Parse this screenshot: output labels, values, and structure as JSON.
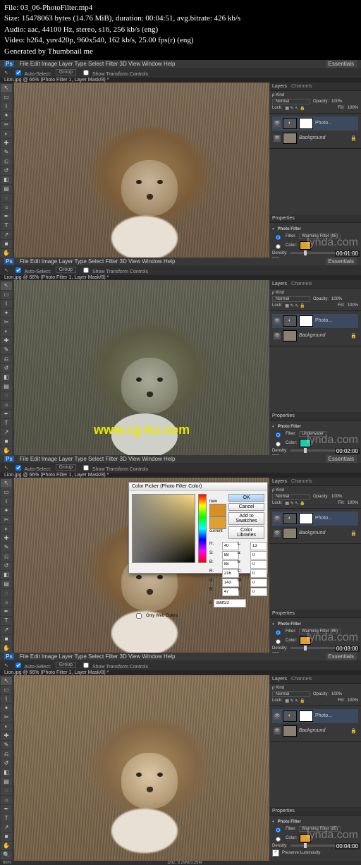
{
  "header": {
    "file": "File: 03_06-PhotoFilter.mp4",
    "size": "Size: 15478063 bytes (14.76 MiB), duration: 00:04:51, avg.bitrate: 426 kb/s",
    "audio": "Audio: aac, 44100 Hz, stereo, s16, 256 kb/s (eng)",
    "video": "Video: h264, yuv420p, 960x540, 162 kb/s, 25.00 fps(r) (eng)",
    "generated": "Generated by Thumbnail me"
  },
  "menu": {
    "ps": "Ps",
    "items": [
      "File",
      "Edit",
      "Image",
      "Layer",
      "Type",
      "Select",
      "Filter",
      "3D",
      "View",
      "Window",
      "Help"
    ]
  },
  "options": {
    "auto_select": "Auto-Select:",
    "group": "Group",
    "show_transform": "Show Transform Controls"
  },
  "essentials": "Essentials",
  "tab": "Lion.jpg @ 66% (Photo Filter 1, Layer Mask/8) *",
  "status_left": "66%",
  "status_doc": "Doc: 3.29M/3.29M",
  "layers_panel": {
    "tabs": [
      "Layers",
      "Channels"
    ],
    "kind": "ρ Kind",
    "blend": "Normal",
    "opacity_label": "Opacity:",
    "opacity": "100%",
    "lock_label": "Lock:",
    "fill_label": "Fill:",
    "fill": "100%",
    "layer1": "Photo...",
    "layer_bg": "Background",
    "lock_icon": "🔒"
  },
  "properties_panel": {
    "tab": "Properties",
    "title": "Photo Filter",
    "filter_label": "Filter:",
    "color_label": "Color:",
    "density_label": "Density:",
    "preserve": "Preserve Luminosity"
  },
  "frames": [
    {
      "timestamp": "00:01:00",
      "filter_name": "Warming Filter (85)",
      "swatch": "#e0a030",
      "tone": "warm"
    },
    {
      "timestamp": "00:02:00",
      "filter_name": "Underwater",
      "swatch": "#20c8b0",
      "tone": "cool",
      "watermark_url": "www.cg-ku.com"
    },
    {
      "timestamp": "00:03:00",
      "filter_name": "Warming Filter (85)",
      "swatch": "#e0a030",
      "tone": "warm",
      "colorpicker": true
    },
    {
      "timestamp": "00:04:00",
      "filter_name": "Warming Filter (85)",
      "swatch": "#e0a030",
      "tone": "warm2"
    }
  ],
  "watermark_lynda": "lynda.com",
  "colorpicker": {
    "title": "Color Picker (Photo Filter Color)",
    "ok": "OK",
    "cancel": "Cancel",
    "add_swatches": "Add to Swatches",
    "color_libraries": "Color Libraries",
    "new": "new",
    "current": "current",
    "H": "40",
    "S": "88",
    "B": "88",
    "R": "216",
    "G": "143",
    "B2": "47",
    "L": "13",
    "a": "0",
    "b": "0",
    "C": "0",
    "M": "0",
    "Y": "0",
    "K": "0",
    "hex_label": "#",
    "hex": "d88f23",
    "webonly": "Only Web Colors"
  }
}
